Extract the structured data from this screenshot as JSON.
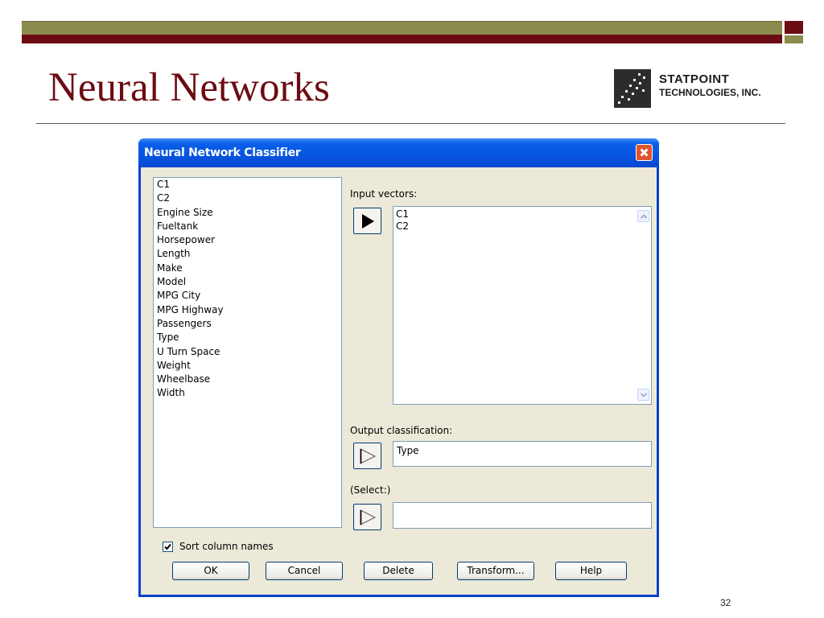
{
  "slide": {
    "title": "Neural Networks",
    "page_number": "32",
    "logo": {
      "line1": "STATPOINT",
      "line2": "TECHNOLOGIES, INC."
    }
  },
  "dialog": {
    "title": "Neural Network Classifier",
    "columns": [
      "C1",
      "C2",
      "Engine Size",
      "Fueltank",
      "Horsepower",
      "Length",
      "Make",
      "Model",
      "MPG City",
      "MPG Highway",
      "Passengers",
      "Type",
      "U Turn Space",
      "Weight",
      "Wheelbase",
      "Width"
    ],
    "input_vectors": {
      "label": "Input vectors:",
      "items": [
        "C1",
        "C2"
      ]
    },
    "output_classification": {
      "label": "Output classification:",
      "value": "Type"
    },
    "select": {
      "label": "(Select:)",
      "value": ""
    },
    "sort_columns": {
      "label": "Sort column names",
      "checked": true
    },
    "buttons": {
      "ok": "OK",
      "cancel": "Cancel",
      "delete": "Delete",
      "transform": "Transform...",
      "help": "Help"
    }
  },
  "colors": {
    "slide_accent": "#6b0c12",
    "slide_band": "#8b8b4e",
    "titlebar": "#0654e0",
    "dialog_face": "#ece9d8"
  },
  "icons": [
    "close-icon",
    "arrow-right-icon",
    "scroll-up-icon",
    "scroll-down-icon",
    "checkmark-icon"
  ]
}
